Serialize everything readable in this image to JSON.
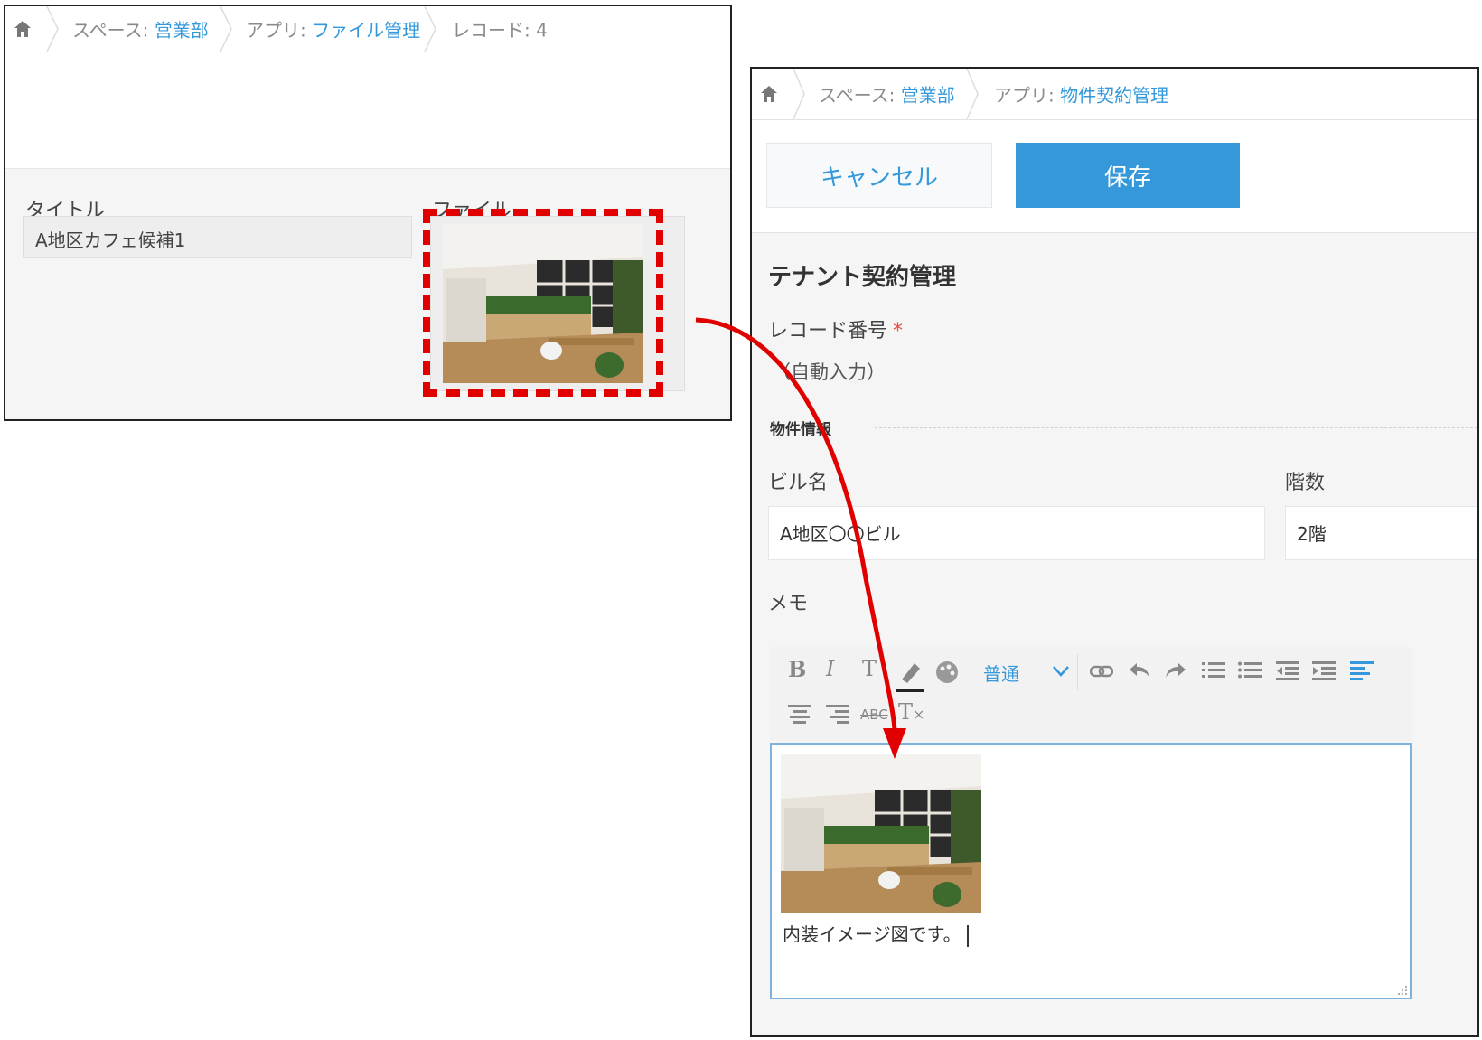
{
  "left_panel": {
    "breadcrumb": {
      "space_label": "スペース: ",
      "space_link": "営業部",
      "app_label": "アプリ: ",
      "app_link": "ファイル管理",
      "record": "レコード: 4"
    },
    "title_label": "タイトル",
    "title_value": "A地区カフェ候補1",
    "file_label": "ファイル"
  },
  "right_panel": {
    "breadcrumb": {
      "space_label": "スペース: ",
      "space_link": "営業部",
      "app_label": "アプリ: ",
      "app_link": "物件契約管理"
    },
    "cancel_label": "キャンセル",
    "save_label": "保存",
    "form_title": "テナント契約管理",
    "record_number_label": "レコード番号",
    "required_mark": "*",
    "auto_input": "（自動入力）",
    "group_label": "物件情報",
    "building_label": "ビル名",
    "building_value": "A地区〇〇ビル",
    "floor_label": "階数",
    "floor_value": "2階",
    "memo_label": "メモ",
    "toolbar": {
      "bold": "B",
      "italic": "I",
      "text_size": "T",
      "font_select": "普通",
      "strike": "ABC",
      "clear_format": "T"
    },
    "memo_text": "内装イメージ図です。"
  },
  "colors": {
    "accent": "#3498db",
    "highlight": "#e00000",
    "required": "#e74c3c"
  }
}
